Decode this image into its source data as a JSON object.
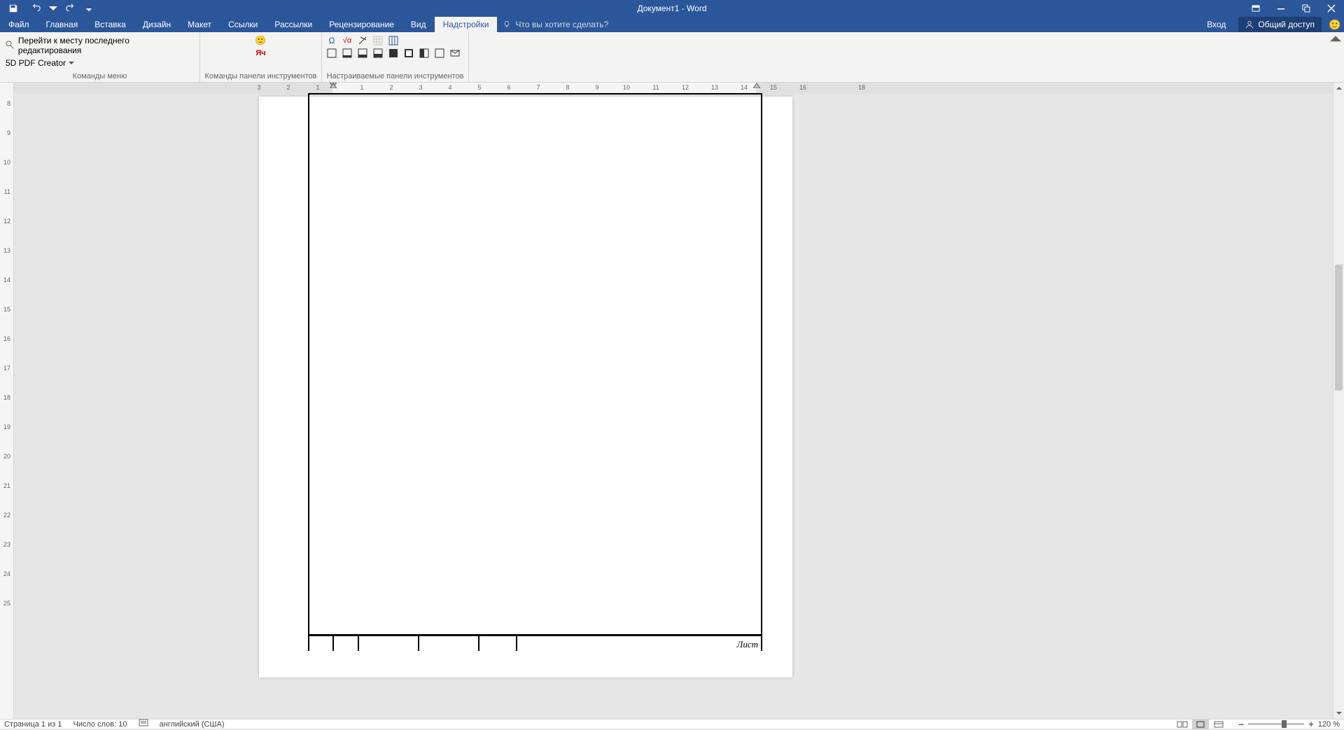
{
  "titlebar": {
    "title": "Документ1 - Word"
  },
  "tabs": {
    "file": "Файл",
    "items": [
      "Главная",
      "Вставка",
      "Дизайн",
      "Макет",
      "Ссылки",
      "Рассылки",
      "Рецензирование",
      "Вид",
      "Надстройки"
    ],
    "active_index": 8,
    "tellme_placeholder": "Что вы хотите сделать?",
    "login": "Вход",
    "share": "Общий доступ"
  },
  "ribbon": {
    "group1": {
      "goto_last_edit": "Перейти к месту последнего редактирования",
      "pdf_creator": "5D PDF Creator",
      "label": "Команды меню"
    },
    "group2": {
      "label": "Команды панели инструментов"
    },
    "group3": {
      "label": "Настраиваемые панели инструментов"
    }
  },
  "ruler": {
    "h_numbers": [
      3,
      2,
      1,
      "",
      "1",
      "2",
      "3",
      "4",
      "5",
      "6",
      "7",
      "8",
      "9",
      "10",
      "11",
      "12",
      "13",
      "14",
      "15",
      "16",
      "",
      "18"
    ],
    "v_numbers": [
      8,
      9,
      10,
      11,
      12,
      13,
      14,
      15,
      16,
      17,
      18,
      19,
      20,
      21,
      22,
      23,
      24,
      25
    ]
  },
  "document": {
    "footer_label": "Лист"
  },
  "statusbar": {
    "page": "Страница 1 из 1",
    "words": "Число слов: 10",
    "language": "английский (США)",
    "zoom": "120 %"
  }
}
